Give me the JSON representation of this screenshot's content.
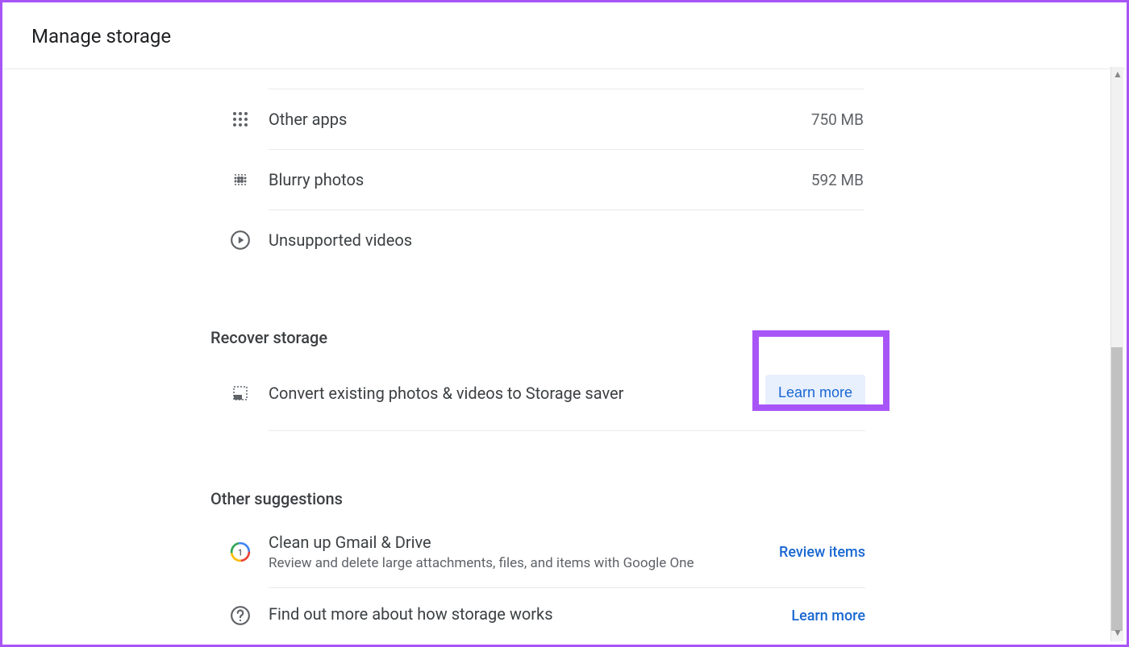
{
  "header": {
    "title": "Manage storage"
  },
  "storage_items": [
    {
      "label": "Other apps",
      "value": "750 MB",
      "icon": "apps-icon"
    },
    {
      "label": "Blurry photos",
      "value": "592 MB",
      "icon": "blur-icon"
    },
    {
      "label": "Unsupported videos",
      "value": "",
      "icon": "play-icon"
    }
  ],
  "recover_storage": {
    "heading": "Recover storage",
    "item": {
      "label": "Convert existing photos & videos to Storage saver",
      "button": "Learn more"
    }
  },
  "other_suggestions": {
    "heading": "Other suggestions",
    "items": [
      {
        "title": "Clean up Gmail & Drive",
        "description": "Review and delete large attachments, files, and items with Google One",
        "action": "Review items",
        "icon": "google-one-icon"
      },
      {
        "title": "Find out more about how storage works",
        "description": "",
        "action": "Learn more",
        "icon": "help-icon"
      }
    ]
  }
}
